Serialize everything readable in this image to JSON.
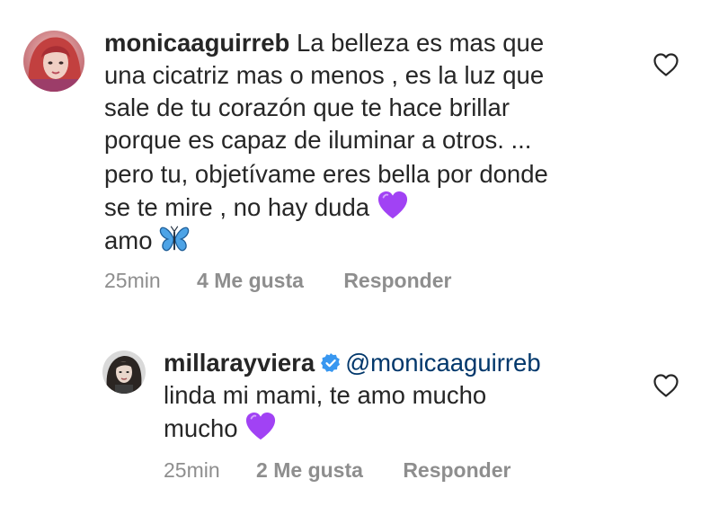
{
  "comments": [
    {
      "username": "monicaaguirreb",
      "lines": [
        "La belleza es mas que",
        "una cicatriz mas o menos , es la luz que",
        "sale de tu corazón que te hace brillar",
        "porque es capaz de iluminar a otros. ...",
        "pero tu, objetívame eres bella por donde",
        "se te mire , no hay duda",
        "amo"
      ],
      "emojis": [
        "purple-heart",
        "butterfly"
      ],
      "time": "25min",
      "likes": "4 Me gusta",
      "reply_label": "Responder"
    },
    {
      "username": "millarayviera",
      "mention": "@monicaaguirreb",
      "lines": [
        "linda mi mami, te amo mucho",
        "mucho"
      ],
      "emojis": [
        "purple-heart"
      ],
      "verified": true,
      "time": "25min",
      "likes": "2 Me gusta",
      "reply_label": "Responder"
    }
  ],
  "icons": {
    "like": "heart-outline-icon",
    "verified": "verified-badge-icon"
  },
  "colors": {
    "text": "#262626",
    "meta": "#8e8e8e",
    "mention": "#00376b",
    "verified": "#3897f0",
    "purple_heart": "#a142f4",
    "butterfly": "#4da3e6"
  }
}
